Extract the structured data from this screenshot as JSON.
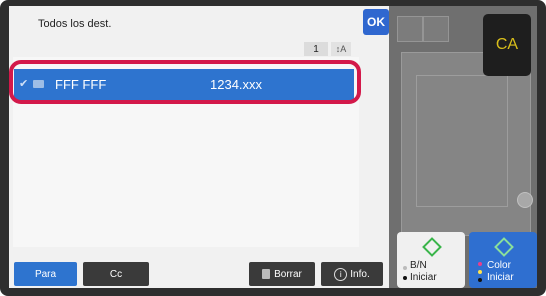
{
  "dialog": {
    "title": "Todos los dest.",
    "ok_label": "OK",
    "page_number": "1",
    "sort_icon": "sort-icon"
  },
  "list": {
    "items": [
      {
        "name": "FFF FFF",
        "address": "1234.xxx",
        "selected": true,
        "icon": "mail-icon"
      }
    ]
  },
  "footer": {
    "para_label": "Para",
    "cc_label": "Cc",
    "borrar_label": "Borrar",
    "info_label": "Info."
  },
  "side": {
    "ca_label": "CA",
    "bw": {
      "line1": "B/N",
      "line2": "Iniciar"
    },
    "color": {
      "line1": "Color",
      "line2": "Iniciar"
    }
  },
  "colors": {
    "accent": "#2e74cf",
    "highlight": "#d3194a",
    "ca_text": "#d9be1a"
  }
}
